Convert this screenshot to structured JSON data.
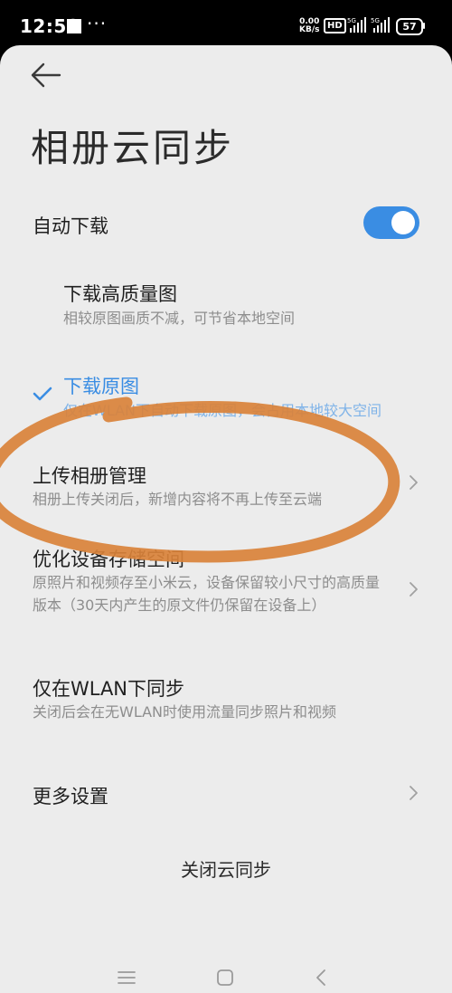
{
  "status_bar": {
    "time": "12:58",
    "dots": "···",
    "net_speed_value": "0.00",
    "net_speed_unit": "KB/s",
    "hd_label": "HD",
    "sig1_label": "5G",
    "sig2_label": "5G",
    "battery": "57"
  },
  "header": {
    "back_icon": "arrow-left-icon",
    "title": "相册云同步"
  },
  "settings": {
    "auto_download": {
      "label": "自动下载",
      "enabled": true
    },
    "high_quality": {
      "title": "下载高质量图",
      "subtitle": "相较原图画质不减，可节省本地空间"
    },
    "original": {
      "title": "下载原图",
      "subtitle": "仅在WLAN下自动下载原图，会占用本地较大空间",
      "selected": true
    },
    "upload_manage": {
      "title": "上传相册管理",
      "subtitle": "相册上传关闭后，新增内容将不再上传至云端"
    },
    "optimize_storage": {
      "title": "优化设备存储空间",
      "subtitle": "原照片和视频存至小米云，设备保留较小尺寸的高质量版本（30天内产生的原文件仍保留在设备上）"
    },
    "wlan_only": {
      "title": "仅在WLAN下同步",
      "subtitle": "关闭后会在无WLAN时使用流量同步照片和视频"
    },
    "more_settings": {
      "title": "更多设置"
    },
    "close_sync": "关闭云同步"
  },
  "nav": {
    "menu_icon": "menu-icon",
    "home_icon": "home-icon",
    "back_icon": "back-icon"
  },
  "colors": {
    "accent": "#3a8de3",
    "annotation": "#d9823a",
    "background": "#ececec"
  }
}
